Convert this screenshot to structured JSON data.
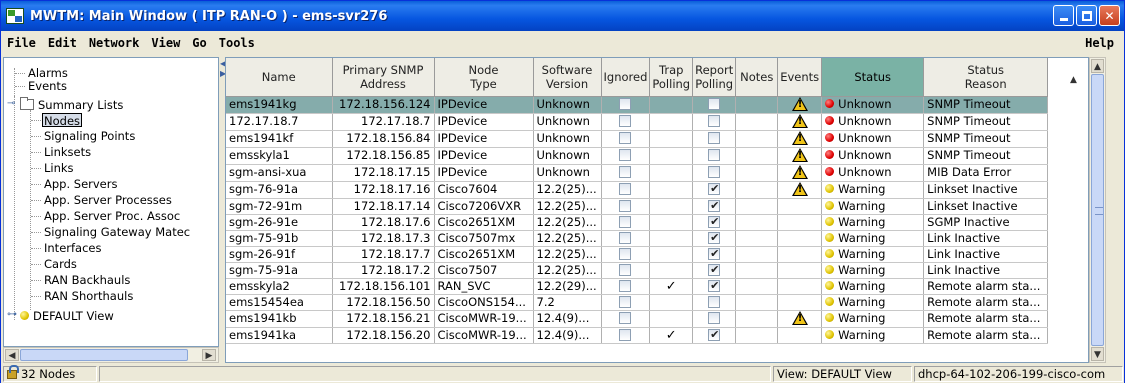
{
  "window": {
    "title": "MWTM: Main Window ( ITP RAN-O )  - ems-svr276"
  },
  "menu": [
    "File",
    "Edit",
    "Network",
    "View",
    "Go",
    "Tools"
  ],
  "menu_help": "Help",
  "tree": {
    "items": [
      {
        "label": "Alarms"
      },
      {
        "label": "Events"
      },
      {
        "label": "Summary Lists"
      },
      {
        "label": "Nodes"
      },
      {
        "label": "Signaling Points"
      },
      {
        "label": "Linksets"
      },
      {
        "label": "Links"
      },
      {
        "label": "App. Servers"
      },
      {
        "label": "App. Server Processes"
      },
      {
        "label": "App. Server Proc. Assoc"
      },
      {
        "label": "Signaling Gateway Matec"
      },
      {
        "label": "Interfaces"
      },
      {
        "label": "Cards"
      },
      {
        "label": "RAN Backhauls"
      },
      {
        "label": "RAN Shorthauls"
      },
      {
        "label": "DEFAULT View"
      }
    ]
  },
  "table": {
    "headers": {
      "name": "Name",
      "snmp_1": "Primary SNMP",
      "snmp_2": "Address",
      "type_1": "Node",
      "type_2": "Type",
      "sw_1": "Software",
      "sw_2": "Version",
      "ignored": "Ignored",
      "trap_1": "Trap",
      "trap_2": "Polling",
      "report_1": "Report",
      "report_2": "Polling",
      "notes": "Notes",
      "events": "Events",
      "status": "Status",
      "reason_1": "Status",
      "reason_2": "Reason"
    },
    "rows": [
      {
        "name": "ems1941kg",
        "address": "172.18.156.124",
        "type": "IPDevice",
        "version": "Unknown",
        "trap": false,
        "report": false,
        "event": true,
        "status": "Unknown",
        "status_color": "red",
        "reason": "SNMP Timeout",
        "selected": true
      },
      {
        "name": "172.17.18.7",
        "address": "172.17.18.7",
        "type": "IPDevice",
        "version": "Unknown",
        "trap": false,
        "report": false,
        "event": true,
        "status": "Unknown",
        "status_color": "red",
        "reason": "SNMP Timeout"
      },
      {
        "name": "ems1941kf",
        "address": "172.18.156.84",
        "type": "IPDevice",
        "version": "Unknown",
        "trap": false,
        "report": false,
        "event": true,
        "status": "Unknown",
        "status_color": "red",
        "reason": "SNMP Timeout"
      },
      {
        "name": "emsskyla1",
        "address": "172.18.156.85",
        "type": "IPDevice",
        "version": "Unknown",
        "trap": false,
        "report": false,
        "event": true,
        "status": "Unknown",
        "status_color": "red",
        "reason": "SNMP Timeout"
      },
      {
        "name": "sgm-ansi-xua",
        "address": "172.18.17.15",
        "type": "IPDevice",
        "version": "Unknown",
        "trap": false,
        "report": false,
        "event": true,
        "status": "Unknown",
        "status_color": "red",
        "reason": "MIB Data Error"
      },
      {
        "name": "sgm-76-91a",
        "address": "172.18.17.16",
        "type": "Cisco7604",
        "version": "12.2(25)...",
        "trap": false,
        "report": true,
        "event": true,
        "status": "Warning",
        "status_color": "yellow",
        "reason": "Linkset Inactive"
      },
      {
        "name": "sgm-72-91m",
        "address": "172.18.17.14",
        "type": "Cisco7206VXR",
        "version": "12.2(25)...",
        "trap": false,
        "report": true,
        "event": false,
        "status": "Warning",
        "status_color": "yellow",
        "reason": "Linkset Inactive"
      },
      {
        "name": "sgm-26-91e",
        "address": "172.18.17.6",
        "type": "Cisco2651XM",
        "version": "12.2(25)...",
        "trap": false,
        "report": true,
        "event": false,
        "status": "Warning",
        "status_color": "yellow",
        "reason": "SGMP Inactive"
      },
      {
        "name": "sgm-75-91b",
        "address": "172.18.17.3",
        "type": "Cisco7507mx",
        "version": "12.2(25)...",
        "trap": false,
        "report": true,
        "event": false,
        "status": "Warning",
        "status_color": "yellow",
        "reason": "Link Inactive"
      },
      {
        "name": "sgm-26-91f",
        "address": "172.18.17.7",
        "type": "Cisco2651XM",
        "version": "12.2(25)...",
        "trap": false,
        "report": true,
        "event": false,
        "status": "Warning",
        "status_color": "yellow",
        "reason": "Link Inactive"
      },
      {
        "name": "sgm-75-91a",
        "address": "172.18.17.2",
        "type": "Cisco7507",
        "version": "12.2(25)...",
        "trap": false,
        "report": true,
        "event": false,
        "status": "Warning",
        "status_color": "yellow",
        "reason": "Link Inactive"
      },
      {
        "name": "emsskyla2",
        "address": "172.18.156.101",
        "type": "RAN_SVC",
        "version": "12.2(29)...",
        "trap": true,
        "report": true,
        "event": false,
        "status": "Warning",
        "status_color": "yellow",
        "reason": "Remote alarm sta..."
      },
      {
        "name": "ems15454ea",
        "address": "172.18.156.50",
        "type": "CiscoONS154...",
        "version": "7.2",
        "trap": false,
        "report": false,
        "event": false,
        "status": "Warning",
        "status_color": "yellow",
        "reason": "Remote alarm sta..."
      },
      {
        "name": "ems1941kb",
        "address": "172.18.156.21",
        "type": "CiscoMWR-19...",
        "version": "12.4(9)...",
        "trap": false,
        "report": false,
        "event": true,
        "status": "Warning",
        "status_color": "yellow",
        "reason": "Remote alarm sta..."
      },
      {
        "name": "ems1941ka",
        "address": "172.18.156.20",
        "type": "CiscoMWR-19...",
        "version": "12.4(9)...",
        "trap": true,
        "report": true,
        "event": false,
        "status": "Warning",
        "status_color": "yellow",
        "reason": "Remote alarm sta..."
      }
    ]
  },
  "statusbar": {
    "count": "32 Nodes",
    "view": "View: DEFAULT View",
    "host": "dhcp-64-102-206-199-cisco-com"
  }
}
